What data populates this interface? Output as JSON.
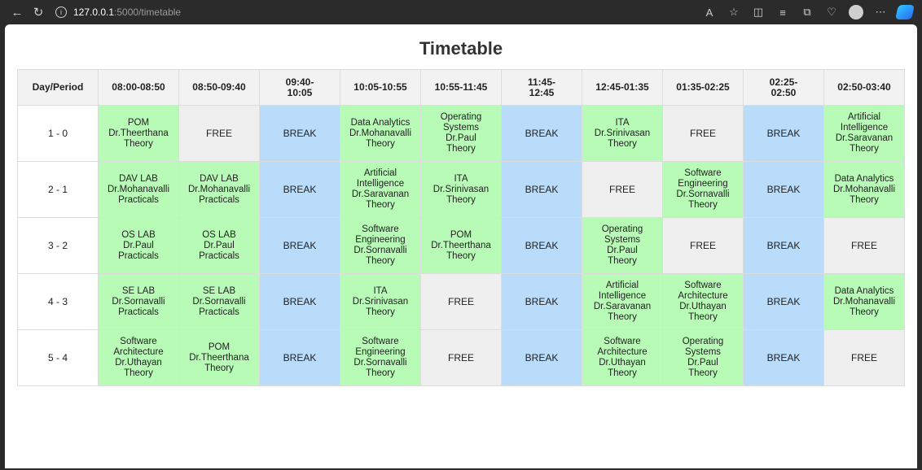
{
  "browser": {
    "url_host": "127.0.0.1",
    "url_path": ":5000/timetable",
    "back_icon": "←",
    "reload_icon": "↻",
    "info_icon": "i"
  },
  "page": {
    "title": "Timetable"
  },
  "table": {
    "header": [
      "Day/Period",
      "08:00-08:50",
      "08:50-09:40",
      "09:40-\n10:05",
      "10:05-10:55",
      "10:55-11:45",
      "11:45-\n12:45",
      "12:45-01:35",
      "01:35-02:25",
      "02:25-\n02:50",
      "02:50-03:40"
    ],
    "rows": [
      {
        "day": "1 - 0",
        "cells": [
          {
            "type": "class",
            "lines": [
              "POM",
              "Dr.Theerthana",
              "Theory"
            ]
          },
          {
            "type": "free",
            "lines": [
              "FREE"
            ]
          },
          {
            "type": "brk",
            "lines": [
              "BREAK"
            ]
          },
          {
            "type": "class",
            "lines": [
              "Data Analytics",
              "Dr.Mohanavalli",
              "Theory"
            ]
          },
          {
            "type": "class",
            "lines": [
              "Operating",
              "Systems",
              "Dr.Paul",
              "Theory"
            ]
          },
          {
            "type": "brk",
            "lines": [
              "BREAK"
            ]
          },
          {
            "type": "class",
            "lines": [
              "ITA",
              "Dr.Srinivasan",
              "Theory"
            ]
          },
          {
            "type": "free",
            "lines": [
              "FREE"
            ]
          },
          {
            "type": "brk",
            "lines": [
              "BREAK"
            ]
          },
          {
            "type": "class",
            "lines": [
              "Artificial",
              "Intelligence",
              "Dr.Saravanan",
              "Theory"
            ]
          }
        ]
      },
      {
        "day": "2 - 1",
        "cells": [
          {
            "type": "class",
            "lines": [
              "DAV LAB",
              "Dr.Mohanavalli",
              "Practicals"
            ]
          },
          {
            "type": "class",
            "lines": [
              "DAV LAB",
              "Dr.Mohanavalli",
              "Practicals"
            ]
          },
          {
            "type": "brk",
            "lines": [
              "BREAK"
            ]
          },
          {
            "type": "class",
            "lines": [
              "Artificial Intelligence",
              "Dr.Saravanan",
              "Theory"
            ]
          },
          {
            "type": "class",
            "lines": [
              "ITA",
              "Dr.Srinivasan",
              "Theory"
            ]
          },
          {
            "type": "brk",
            "lines": [
              "BREAK"
            ]
          },
          {
            "type": "free",
            "lines": [
              "FREE"
            ]
          },
          {
            "type": "class",
            "lines": [
              "Software",
              "Engineering",
              "Dr.Sornavalli",
              "Theory"
            ]
          },
          {
            "type": "brk",
            "lines": [
              "BREAK"
            ]
          },
          {
            "type": "class",
            "lines": [
              "Data Analytics",
              "Dr.Mohanavalli",
              "Theory"
            ]
          }
        ]
      },
      {
        "day": "3 - 2",
        "cells": [
          {
            "type": "class",
            "lines": [
              "OS LAB",
              "Dr.Paul",
              "Practicals"
            ]
          },
          {
            "type": "class",
            "lines": [
              "OS LAB",
              "Dr.Paul",
              "Practicals"
            ]
          },
          {
            "type": "brk",
            "lines": [
              "BREAK"
            ]
          },
          {
            "type": "class",
            "lines": [
              "Software",
              "Engineering",
              "Dr.Sornavalli",
              "Theory"
            ]
          },
          {
            "type": "class",
            "lines": [
              "POM",
              "Dr.Theerthana",
              "Theory"
            ]
          },
          {
            "type": "brk",
            "lines": [
              "BREAK"
            ]
          },
          {
            "type": "class",
            "lines": [
              "Operating Systems",
              "Dr.Paul",
              "Theory"
            ]
          },
          {
            "type": "free",
            "lines": [
              "FREE"
            ]
          },
          {
            "type": "brk",
            "lines": [
              "BREAK"
            ]
          },
          {
            "type": "free",
            "lines": [
              "FREE"
            ]
          }
        ]
      },
      {
        "day": "4 - 3",
        "cells": [
          {
            "type": "class",
            "lines": [
              "SE LAB",
              "Dr.Sornavalli",
              "Practicals"
            ]
          },
          {
            "type": "class",
            "lines": [
              "SE LAB",
              "Dr.Sornavalli",
              "Practicals"
            ]
          },
          {
            "type": "brk",
            "lines": [
              "BREAK"
            ]
          },
          {
            "type": "class",
            "lines": [
              "ITA",
              "Dr.Srinivasan",
              "Theory"
            ]
          },
          {
            "type": "free",
            "lines": [
              "FREE"
            ]
          },
          {
            "type": "brk",
            "lines": [
              "BREAK"
            ]
          },
          {
            "type": "class",
            "lines": [
              "Artificial",
              "Intelligence",
              "Dr.Saravanan",
              "Theory"
            ]
          },
          {
            "type": "class",
            "lines": [
              "Software",
              "Architecture",
              "Dr.Uthayan",
              "Theory"
            ]
          },
          {
            "type": "brk",
            "lines": [
              "BREAK"
            ]
          },
          {
            "type": "class",
            "lines": [
              "Data Analytics",
              "Dr.Mohanavalli",
              "Theory"
            ]
          }
        ]
      },
      {
        "day": "5 - 4",
        "cells": [
          {
            "type": "class",
            "lines": [
              "Software",
              "Architecture",
              "Dr.Uthayan",
              "Theory"
            ]
          },
          {
            "type": "class",
            "lines": [
              "POM",
              "Dr.Theerthana",
              "Theory"
            ]
          },
          {
            "type": "brk",
            "lines": [
              "BREAK"
            ]
          },
          {
            "type": "class",
            "lines": [
              "Software",
              "Engineering",
              "Dr.Sornavalli",
              "Theory"
            ]
          },
          {
            "type": "free",
            "lines": [
              "FREE"
            ]
          },
          {
            "type": "brk",
            "lines": [
              "BREAK"
            ]
          },
          {
            "type": "class",
            "lines": [
              "Software",
              "Architecture",
              "Dr.Uthayan",
              "Theory"
            ]
          },
          {
            "type": "class",
            "lines": [
              "Operating Systems",
              "Dr.Paul",
              "Theory"
            ]
          },
          {
            "type": "brk",
            "lines": [
              "BREAK"
            ]
          },
          {
            "type": "free",
            "lines": [
              "FREE"
            ]
          }
        ]
      }
    ]
  }
}
